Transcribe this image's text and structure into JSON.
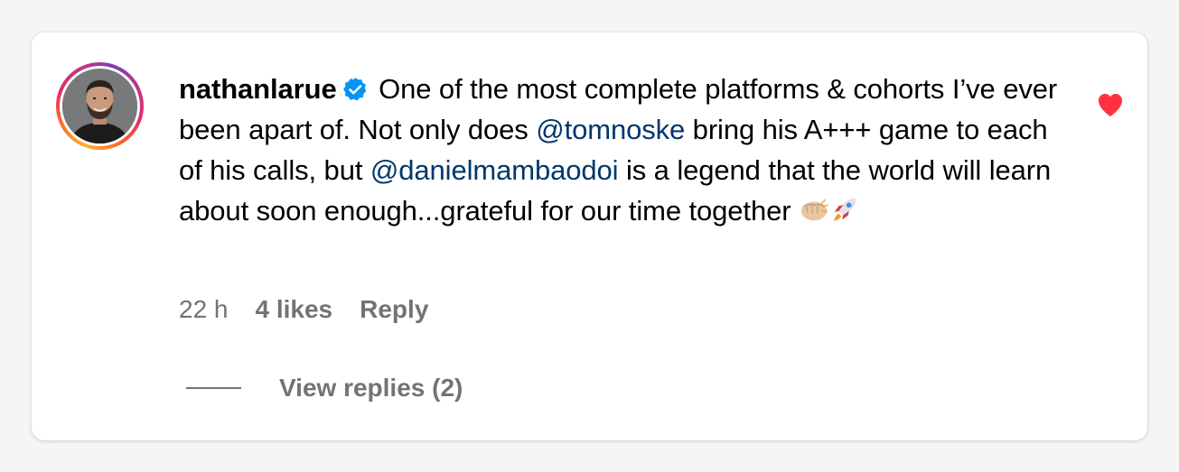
{
  "comment": {
    "username": "nathanlarue",
    "verified_icon": "verified-badge-icon",
    "text_part1": " One of the most complete platforms & cohorts I’ve ever been apart of. Not only does ",
    "mention1": "@tomnoske",
    "text_part2": " bring his A+++ game to each of his calls, but ",
    "mention2": "@danielmambaodoi",
    "text_part3": " is a legend that the world will learn about soon enough...grateful for our time together ",
    "emojis": [
      "fist-bump-emoji",
      "rocket-emoji"
    ],
    "liked": true,
    "heart_icon": "heart-icon"
  },
  "meta": {
    "time": "22 h",
    "likes": "4 likes",
    "reply": "Reply"
  },
  "replies": {
    "label": "View replies (2)"
  },
  "colors": {
    "mention": "#00376b",
    "verified": "#0095f6",
    "heart": "#ff3040",
    "secondary_text": "#737373"
  }
}
